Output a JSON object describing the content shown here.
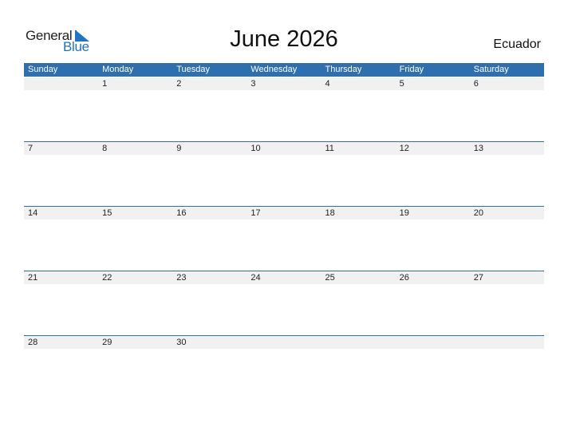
{
  "logo": {
    "word1": "General",
    "word2": "Blue",
    "icon": "triangle-flag-icon",
    "accent": "#1f74c4"
  },
  "title": "June 2026",
  "country": "Ecuador",
  "colors": {
    "header_bg": "#2e6fb0",
    "date_strip_bg": "#f1f1f1"
  },
  "weekdays": [
    "Sunday",
    "Monday",
    "Tuesday",
    "Wednesday",
    "Thursday",
    "Friday",
    "Saturday"
  ],
  "weeks": [
    [
      "",
      "1",
      "2",
      "3",
      "4",
      "5",
      "6"
    ],
    [
      "7",
      "8",
      "9",
      "10",
      "11",
      "12",
      "13"
    ],
    [
      "14",
      "15",
      "16",
      "17",
      "18",
      "19",
      "20"
    ],
    [
      "21",
      "22",
      "23",
      "24",
      "25",
      "26",
      "27"
    ],
    [
      "28",
      "29",
      "30",
      "",
      "",
      "",
      ""
    ]
  ]
}
